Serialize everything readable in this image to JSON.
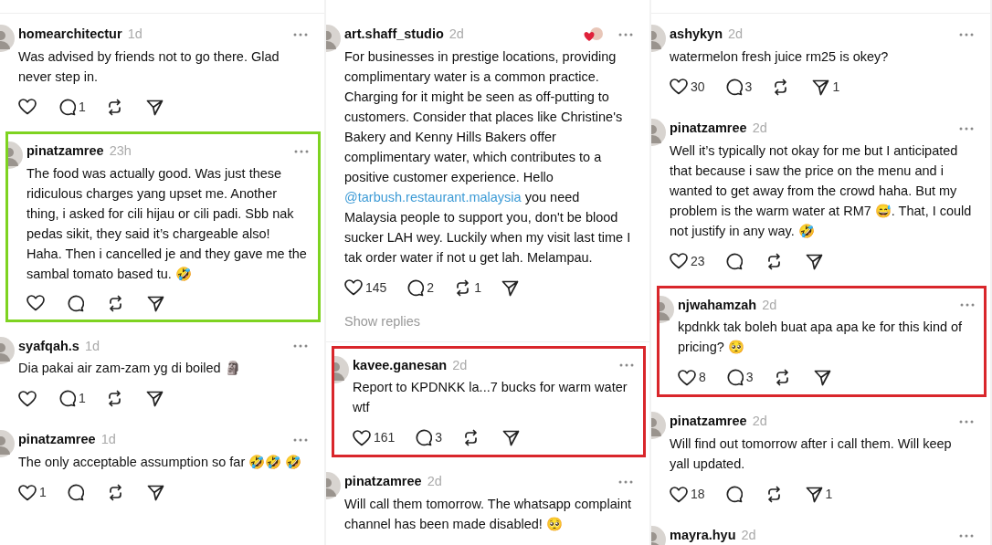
{
  "columns": [
    {
      "top_rule": true,
      "comments": [
        {
          "user": "homearchitectur",
          "time": "1d",
          "text": "Was advised by friends not to go there. Glad never step in.",
          "highlighted": false,
          "stats": {
            "replies": "1"
          }
        },
        {
          "user": "pinatzamree",
          "time": "23h",
          "text": "The food was actually good. Was just these ridiculous charges yang upset me. Another thing, i asked for cili hijau or cili padi. Sbb nak pedas sikit, they said it’s chargeable also! Haha. Then i cancelled je and they gave me the sambal tomato based tu. 🤣",
          "highlighted": true,
          "color": "#7ed321"
        },
        {
          "user": "syafqah.s",
          "time": "1d",
          "text": "Dia pakai air zam-zam yg di boiled 🗿",
          "highlighted": false,
          "stats": {
            "replies": "1"
          }
        },
        {
          "user": "pinatzamree",
          "time": "1d",
          "text": "The only acceptable assumption so far 🤣🤣 🤣",
          "highlighted": false,
          "stats": {
            "likes": "1"
          }
        }
      ]
    },
    {
      "top_rule": false,
      "comments": [
        {
          "user": "art.shaff_studio",
          "time": "2d",
          "liked_by_author": true,
          "parts": [
            {
              "kind": "text",
              "text": "For businesses in prestige locations, providing complimentary water is a common practice. Charging for it might be seen as off-putting to customers. Consider that places like Christine's Bakery and Kenny Hills Bakers offer complimentary water, which contributes to a positive customer experience. Hello "
            },
            {
              "kind": "mention",
              "text": "@tarbush.restaurant.malaysia"
            },
            {
              "kind": "text",
              "text": " you need Malaysia people to support you, don't be blood sucker LAH wey. Luckily when my visit last time I tak order water if not u get lah. Melampau."
            }
          ],
          "highlighted": false,
          "stats": {
            "likes": "145",
            "replies": "2",
            "reposts": "1"
          },
          "show_replies": "Show replies"
        },
        {
          "user": "kavee.ganesan",
          "time": "2d",
          "text": "Report to KPDNKK la...7 bucks for warm water wtf",
          "highlighted": true,
          "color": "#d9262b",
          "stats": {
            "likes": "161",
            "replies": "3"
          }
        },
        {
          "user": "pinatzamree",
          "time": "2d",
          "text": "Will call them tomorrow. The whatsapp complaint channel has been made disabled! 🥺",
          "highlighted": false
        }
      ]
    },
    {
      "top_rule": true,
      "comments": [
        {
          "user": "ashykyn",
          "time": "2d",
          "text": "watermelon fresh juice rm25 is okey?",
          "highlighted": false,
          "stats": {
            "likes": "30",
            "replies": "3",
            "shares": "1"
          }
        },
        {
          "user": "pinatzamree",
          "time": "2d",
          "text": "Well it’s typically not okay for me but I anticipated that because i saw the price on the menu and i wanted to get away from the crowd haha. But my problem is the warm water at RM7 😅. That, I could not justify in any way. 🤣",
          "highlighted": false,
          "stats": {
            "likes": "23"
          }
        },
        {
          "user": "njwahamzah",
          "time": "2d",
          "text": "kpdnkk tak boleh buat apa apa ke for this kind of pricing? 🥺",
          "highlighted": true,
          "color": "#d9262b",
          "stats": {
            "likes": "8",
            "replies": "3"
          }
        },
        {
          "user": "pinatzamree",
          "time": "2d",
          "text": "Will find out tomorrow after i call them. Will keep yall updated.",
          "highlighted": false,
          "stats": {
            "likes": "18",
            "shares": "1"
          }
        },
        {
          "user": "mayra.hyu",
          "time": "2d",
          "highlighted": false
        }
      ]
    }
  ]
}
